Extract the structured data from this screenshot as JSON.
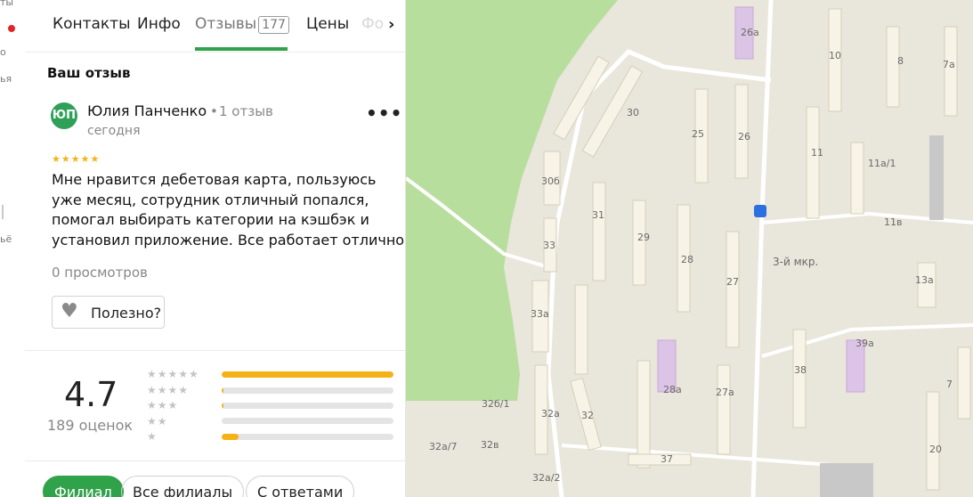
{
  "left_strip": {
    "line1": "ты",
    "line2": "о",
    "line3": "ья",
    "line4": "ьё"
  },
  "tabs": [
    {
      "label": "Контакты"
    },
    {
      "label": "Инфо"
    },
    {
      "label": "Отзывы",
      "count": "177"
    },
    {
      "label": "Цены"
    },
    {
      "label": "Фо"
    }
  ],
  "tabs_more_icon": "chevron-right-icon",
  "section_title": "Ваш отзыв",
  "review": {
    "avatar_initials": "ЮП",
    "author": "Юлия Панченко",
    "separator": "•",
    "author_reviews": "1 отзыв",
    "date": "сегодня",
    "more": "•••",
    "stars": 5,
    "stars_text": "★★★★★",
    "text": "Мне нравится дебетовая карта, пользуюсь уже месяц, сотрудник отличный попался, помогал выбирать категории на кэшбэк и установил приложение. Все работает отлично",
    "views": "0 просмотров",
    "useful_label": "Полезно?"
  },
  "summary": {
    "rating": "4.7",
    "count_label": "189 оценок",
    "distribution": [
      {
        "stars": "★★★★★",
        "fraction": 1.0
      },
      {
        "stars": "★★★★",
        "fraction": 0.01
      },
      {
        "stars": "★★★",
        "fraction": 0.01
      },
      {
        "stars": "★★",
        "fraction": 0.0
      },
      {
        "stars": "★",
        "fraction": 0.1
      }
    ]
  },
  "filters": [
    {
      "label": "Филиал",
      "active": true
    },
    {
      "label": "Все филиалы",
      "active": false
    },
    {
      "label": "С ответами",
      "active": false
    }
  ],
  "colors": {
    "accent": "#2fa24a",
    "star": "#f5b217",
    "avatar": "#2fa058"
  },
  "map": {
    "labels": [
      "30",
      "26а",
      "10",
      "8",
      "7а",
      "25",
      "26",
      "11",
      "11а/1",
      "30б",
      "31",
      "11в",
      "29",
      "28",
      "33",
      "27",
      "3-й мкр.",
      "13а",
      "33а",
      "39а",
      "38",
      "28а",
      "27а",
      "7",
      "32б/1",
      "32",
      "32а",
      "32а/7",
      "32в",
      "37",
      "20",
      "32а/2"
    ]
  }
}
